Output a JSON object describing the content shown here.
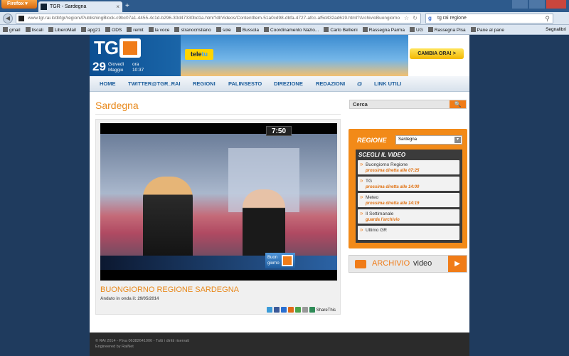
{
  "browser": {
    "menu_button": "Firefox",
    "tab_title": "TGR - Sardegna",
    "new_tab": "+",
    "url": "www.tgr.rai.it/dl/tgr/regioni/PublishingBlock-c9bc07a1-4455-4c1d-b296-30d47330bd1a.html?dl/Videos/ContentItem-51a0cd98-dbfa-4727-afcc-af5d432ad619.html?ArchivioBuongiorno",
    "search_text": "tg rai regione",
    "bookmarks": [
      "gmail",
      "tiscali",
      "LiberoMail",
      "apg21",
      "ODS",
      "remit",
      "la voce",
      "stranocristiano",
      "sole",
      "Bussola",
      "Coordinamento Nazio...",
      "Carlo Bellieni",
      "Rassegna Parma",
      "UG",
      "Rassegna Pisa",
      "Pane al pane"
    ],
    "bookmarks_right": "Segnalibri"
  },
  "header": {
    "logo_text": "TG",
    "day": "29",
    "weekday": "Giovedì",
    "month": "Maggio",
    "ora_label": "ora",
    "time": "10:37",
    "teletu": "tele",
    "teletu_b": "tu",
    "cambia": "CAMBIA ORA! >"
  },
  "menu": [
    "HOME",
    "TWITTER@TGR_RAI",
    "REGIONI",
    "PALINSESTO",
    "DIREZIONE",
    "REDAZIONI",
    "@",
    "LINK UTILI"
  ],
  "page": {
    "title": "Sardegna",
    "search_placeholder": "Cerca",
    "search_btn": "🔍"
  },
  "video": {
    "clock": "7:50",
    "bug_line1": "Buon",
    "bug_line2": "giorno",
    "title": "BUONGIORNO REGIONE SARDEGNA",
    "aired": "Andato in onda il: 29/05/2014",
    "share_label": "ShareThis"
  },
  "sidebar": {
    "region_label": "REGIONE",
    "region_value": "Sardegna",
    "scegli": "SCEGLI IL VIDEO",
    "items": [
      {
        "name": "Buongiorno Regione",
        "sub": "prossima diretta alle 07:25"
      },
      {
        "name": "TG",
        "sub": "prossima diretta alle 14:00"
      },
      {
        "name": "Meteo",
        "sub": "prossima diretta alle 14:19"
      },
      {
        "name": "Il Settimanale",
        "sub": "guarda l'archivio"
      },
      {
        "name": "Ultimo GR",
        "sub": ""
      }
    ],
    "archivio_a": "ARCHIVIO",
    "archivio_b": "video",
    "archivio_play": "▶"
  },
  "footer": {
    "line1": "© RAI 2014 - P.iva 06382641006 - Tutti i diritti riservati",
    "line2": "Engineered by RaiNet"
  },
  "colors": {
    "accent": "#f07c18",
    "link": "#1b5c9b",
    "title_orange": "#e8891c"
  }
}
